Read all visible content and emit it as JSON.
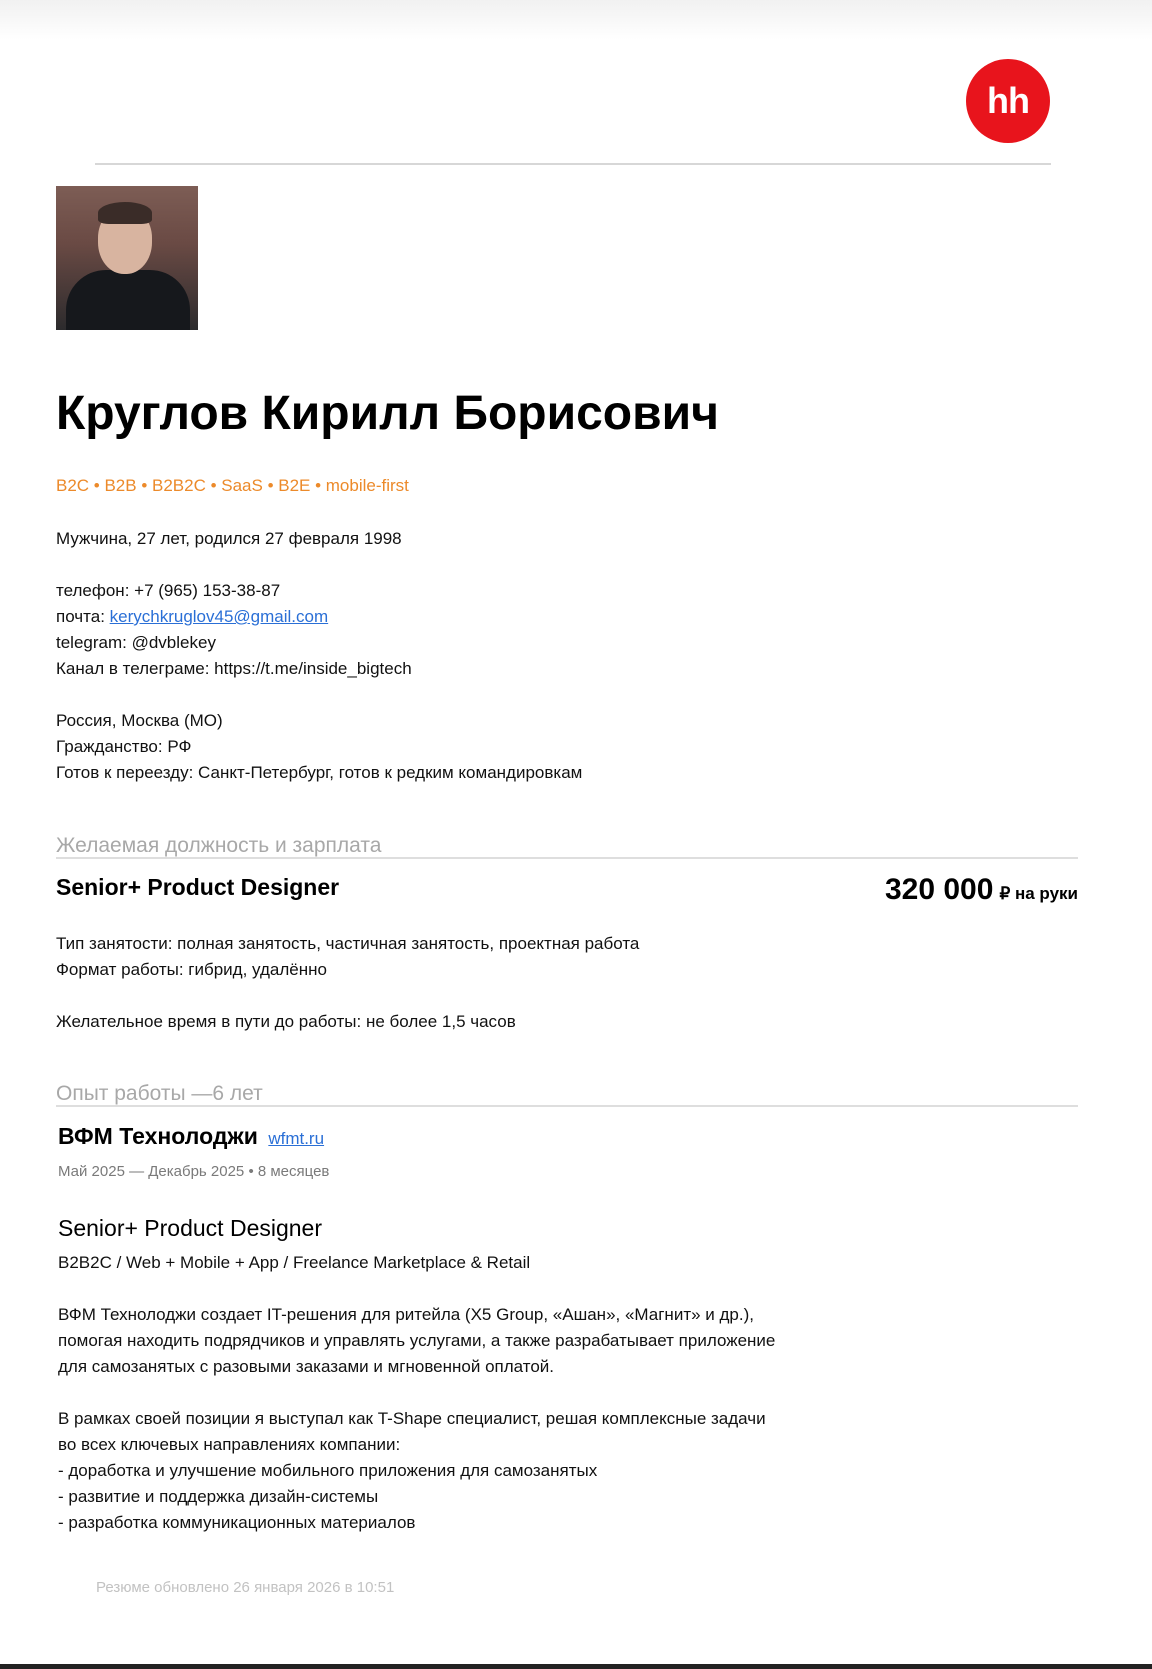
{
  "logo": {
    "text": "hh"
  },
  "profile": {
    "name": "Круглов Кирилл Борисович",
    "tags": "B2C • B2B • B2B2C • SaaS • B2E • mobile-first",
    "personal": "Мужчина, 27 лет, родился 27 февраля 1998",
    "phone": "телефон: +7 (965) 153-38-87",
    "email_label": "почта: ",
    "email": "kerychkruglov45@gmail.com",
    "telegram": "telegram: @dvblekey",
    "channel": "Канал в телеграме: https://t.me/inside_bigtech",
    "location": "Россия, Москва (МО)",
    "citizenship": "Гражданство: РФ",
    "relocation": "Готов к переезду: Санкт-Петербург, готов к редким командировкам"
  },
  "desired": {
    "section_title": "Желаемая должность и зарплата",
    "position": "Senior+ Product Designer",
    "salary_amount": "320 000",
    "salary_unit": "₽ на руки",
    "employment_type": "Тип занятости: полная занятость, частичная занятость, проектная работа",
    "work_format": "Формат работы: гибрид, удалённо",
    "commute": "Желательное время в пути до работы: не более 1,5 часов"
  },
  "experience": {
    "section_title": "Опыт работы —6 лет",
    "company": "ВФМ Технолоджи",
    "company_site": "wfmt.ru",
    "period": "Май 2025 — Декабрь 2025 • 8 месяцев",
    "role": "Senior+ Product Designer",
    "scope": "B2B2C / Web + Mobile + App / Freelance Marketplace & Retail",
    "description": [
      "ВФМ Технолоджи создает IT-решения для ритейла (X5 Group, «Ашан», «Магнит» и др.),",
      "помогая находить подрядчиков и управлять услугами, а также разрабатывает приложение",
      "для самозанятых с разовыми заказами и мгновенной оплатой."
    ],
    "responsibilities": [
      "В рамках своей позиции я выступал как T-Shape специалист, решая комплексные задачи",
      "во всех ключевых направлениях компании:",
      "- доработка и улучшение мобильного приложения для самозанятых",
      "- развитие и поддержка дизайн-системы",
      "- разработка коммуникационных материалов"
    ]
  },
  "footer": {
    "updated": "Резюме обновлено 26 января 2026 в 10:51"
  },
  "colors": {
    "accent_orange": "#ec8a2a",
    "link_blue": "#2a6fd6",
    "hh_red": "#e8141c"
  }
}
